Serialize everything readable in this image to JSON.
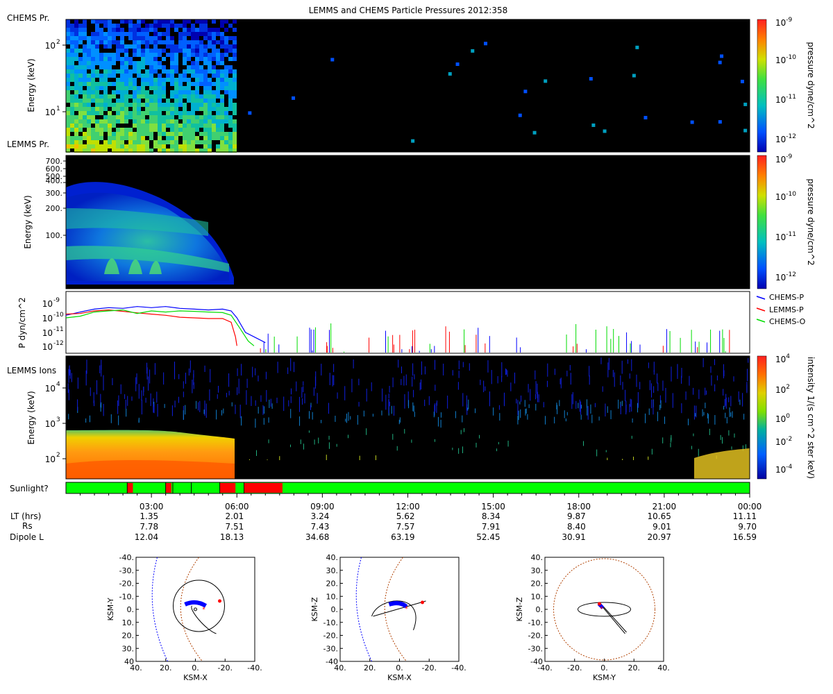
{
  "figure": {
    "title": "LEMMS and CHEMS Particle Pressures  2012:358"
  },
  "panels": {
    "chems_pr": {
      "label": "CHEMS Pr.",
      "ylabel": "Energy (keV)",
      "yticks": [
        "10",
        "10"
      ],
      "ytick_exps": [
        "2",
        "1"
      ],
      "colorbar_label": "pressure dyne/cm^2",
      "colorbar_ticks": [
        "10",
        "10",
        "10",
        "10"
      ],
      "colorbar_exps": [
        "-9",
        "-10",
        "-11",
        "-12"
      ]
    },
    "lemms_pr": {
      "label": "LEMMS Pr.",
      "ylabel": "Energy (keV)",
      "yticks": [
        "700.",
        "600.",
        "500.",
        "400.",
        "300.",
        "200.",
        "100."
      ],
      "colorbar_label": "pressure dyne/cm^2",
      "colorbar_ticks": [
        "10",
        "10",
        "10",
        "10"
      ],
      "colorbar_exps": [
        "-9",
        "-10",
        "-11",
        "-12"
      ]
    },
    "pressure": {
      "ylabel": "P dyn/cm^2",
      "yticks": [
        "10",
        "10",
        "10",
        "10"
      ],
      "ytick_exps": [
        "-9",
        "-10",
        "-11",
        "-12"
      ],
      "legend": [
        "CHEMS-P",
        "LEMMS-P",
        "CHEMS-O"
      ],
      "colors": [
        "#0000ff",
        "#ff0000",
        "#00dd00"
      ]
    },
    "lemms_ions": {
      "label": "LEMMS Ions",
      "ylabel": "Energy (keV)",
      "yticks": [
        "10",
        "10",
        "10"
      ],
      "ytick_exps": [
        "4",
        "3",
        "2"
      ],
      "colorbar_label": "intensity 1/(s cm^2 ster keV)",
      "colorbar_ticks": [
        "10",
        "10",
        "10",
        "10",
        "10"
      ],
      "colorbar_exps": [
        "4",
        "2",
        "0",
        "-2",
        "-4"
      ]
    },
    "sunlight": {
      "label": "Sunlight?",
      "colors": {
        "sun": "#00ff00",
        "shadow": "#ff0000"
      },
      "shadow_intervals_hours": [
        [
          2.15,
          2.35
        ],
        [
          3.5,
          3.7
        ],
        [
          5.4,
          5.95
        ],
        [
          6.25,
          7.6
        ]
      ],
      "gap_ticks_hours": [
        2.15,
        3.5,
        3.75,
        4.4,
        5.4,
        6.25
      ]
    }
  },
  "time_axis": {
    "ticks": [
      "03:00",
      "06:00",
      "09:00",
      "12:00",
      "15:00",
      "18:00",
      "21:00",
      "00:00"
    ],
    "rows": [
      {
        "label": "LT (hrs)",
        "values": [
          "1.35",
          "2.01",
          "3.24",
          "5.62",
          "8.34",
          "9.87",
          "10.65",
          "11.11"
        ]
      },
      {
        "label": "Rs",
        "values": [
          "7.78",
          "7.51",
          "7.43",
          "7.57",
          "7.91",
          "8.40",
          "9.01",
          "9.70"
        ]
      },
      {
        "label": "Dipole L",
        "values": [
          "12.04",
          "18.13",
          "34.68",
          "63.19",
          "52.45",
          "30.91",
          "20.97",
          "16.59"
        ]
      }
    ]
  },
  "chart_data": {
    "type": "line",
    "title": "LEMMS and CHEMS Particle Pressures  2012:358",
    "x_unit": "hours of day 2012:358 (UT)",
    "xlim": [
      0,
      24
    ],
    "ylabel": "P dyn/cm^2",
    "yscale": "log",
    "ylim": [
      1e-12,
      2e-09
    ],
    "series": [
      {
        "name": "CHEMS-P",
        "color": "#0000ff",
        "x": [
          0,
          0.5,
          1,
          1.5,
          2,
          2.5,
          3,
          3.5,
          4,
          4.5,
          5,
          5.5,
          5.8,
          6.0,
          6.3,
          6.6,
          7.0
        ],
        "y": [
          1.5e-10,
          2.5e-10,
          4e-10,
          5e-10,
          4.5e-10,
          6e-10,
          5e-10,
          6e-10,
          4.5e-10,
          4e-10,
          3.5e-10,
          4e-10,
          3e-10,
          1e-10,
          1e-11,
          5e-12,
          2e-12
        ]
      },
      {
        "name": "LEMMS-P",
        "color": "#ff0000",
        "x": [
          0,
          0.5,
          1,
          1.5,
          2,
          2.5,
          3,
          3.5,
          4,
          4.5,
          5,
          5.5,
          5.8,
          5.95,
          6.0
        ],
        "y": [
          1.8e-10,
          2e-10,
          3e-10,
          3.5e-10,
          2.8e-10,
          2.2e-10,
          1.8e-10,
          1.5e-10,
          1.1e-10,
          1e-10,
          9e-11,
          9e-11,
          5e-11,
          5e-12,
          1.2e-12
        ]
      },
      {
        "name": "CHEMS-O",
        "color": "#00dd00",
        "x": [
          0,
          0.5,
          1,
          1.5,
          2,
          2.5,
          3,
          3.5,
          4,
          4.5,
          5,
          5.5,
          5.8,
          6.1,
          6.4,
          6.6
        ],
        "y": [
          1e-10,
          1.3e-10,
          2.5e-10,
          3e-10,
          3.5e-10,
          2e-10,
          3e-10,
          2.5e-10,
          3e-10,
          2.8e-10,
          2.5e-10,
          2.3e-10,
          1.5e-10,
          2e-11,
          2.5e-12,
          1.2e-12
        ]
      }
    ]
  },
  "orbits": [
    {
      "xlabel": "KSM-X",
      "ylabel": "KSM-Y",
      "xticks": [
        "40.",
        "20.",
        "0.",
        "-20.",
        "-40."
      ],
      "yticks": [
        "-40.",
        "-30.",
        "-20.",
        "-10.",
        "0.",
        "10.",
        "20.",
        "30.",
        "40"
      ]
    },
    {
      "xlabel": "KSM-X",
      "ylabel": "KSM-Z",
      "xticks": [
        "40.",
        "20.",
        "0.",
        "-20.",
        "-40."
      ],
      "yticks": [
        "40.",
        "30.",
        "20.",
        "10.",
        "0.",
        "-10.",
        "-20.",
        "-30.",
        "-40"
      ]
    },
    {
      "xlabel": "KSM-Y",
      "ylabel": "KSM-Z",
      "xticks": [
        "-40.",
        "-20.",
        "0.",
        "20.",
        "40."
      ],
      "yticks": [
        "40.",
        "30.",
        "20.",
        "10.",
        "0.",
        "-10.",
        "-20.",
        "-30.",
        "-40"
      ]
    }
  ]
}
